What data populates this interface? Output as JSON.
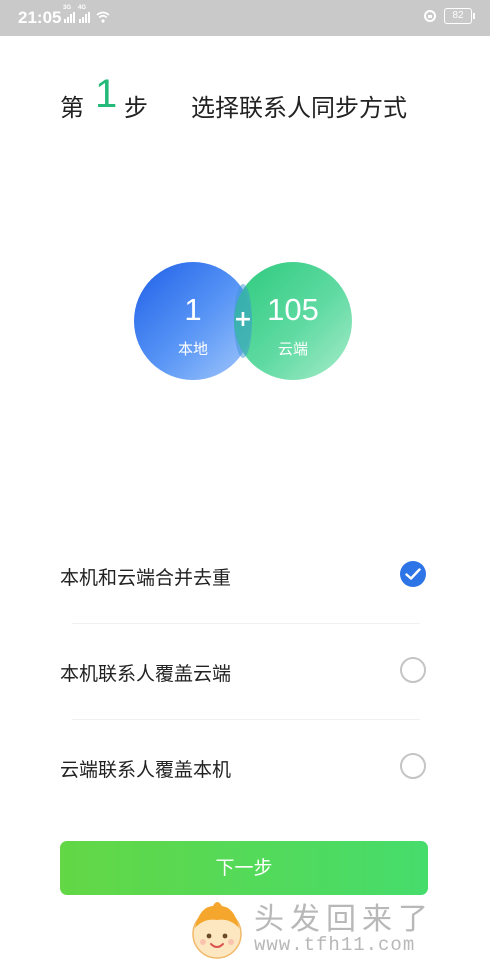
{
  "status_bar": {
    "time": "21:05",
    "signal_1_type": "3G",
    "signal_2_type": "4G",
    "battery": "82",
    "icons": [
      "signal-icon",
      "signal-icon",
      "wifi-icon",
      "lock-rotation-icon",
      "battery-icon"
    ]
  },
  "header": {
    "prefix": "第",
    "step_number": "1",
    "suffix": "步",
    "title": "选择联系人同步方式"
  },
  "venn": {
    "local": {
      "count": "1",
      "label": "本地"
    },
    "plus": "+",
    "cloud": {
      "count": "105",
      "label": "云端"
    }
  },
  "options": [
    {
      "label": "本机和云端合并去重",
      "selected": true
    },
    {
      "label": "本机联系人覆盖云端",
      "selected": false
    },
    {
      "label": "云端联系人覆盖本机",
      "selected": false
    }
  ],
  "next_button": {
    "label": "下一步"
  },
  "watermark": {
    "text": "头发回来了",
    "url": "www.tfh11.com"
  },
  "colors": {
    "accent_green": "#25b97a",
    "check_blue": "#2d74e6",
    "button_green": "#52d95a",
    "local_blue": "#1f5fe8",
    "cloud_green": "#1fc775"
  }
}
